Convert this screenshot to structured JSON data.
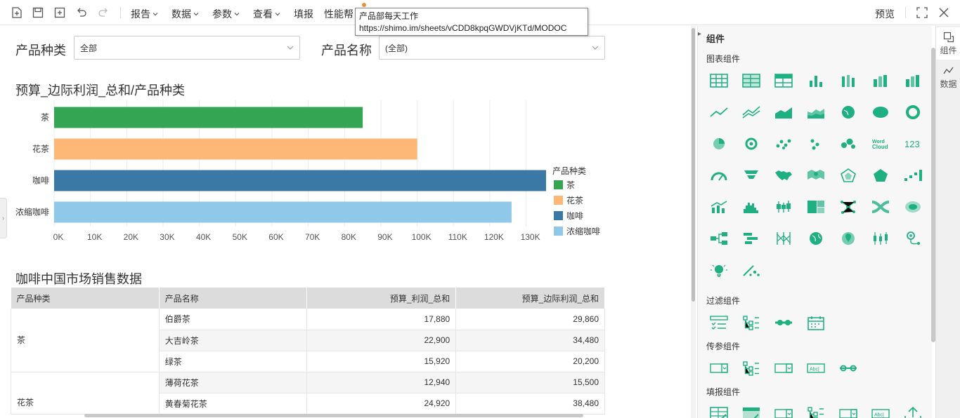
{
  "toolbar": {
    "menus": [
      {
        "id": "report",
        "label": "报告"
      },
      {
        "id": "data",
        "label": "数据"
      },
      {
        "id": "params",
        "label": "参数"
      },
      {
        "id": "view",
        "label": "查看"
      },
      {
        "id": "fill",
        "label": "填报"
      },
      {
        "id": "perf",
        "label": "性能帮"
      }
    ],
    "preview_label": "预览"
  },
  "tooltip": {
    "line1": "产品部每天工作",
    "line2": "https://shimo.im/sheets/vCDD8kpqGWDVjKTd/MODOC"
  },
  "filters": {
    "category_label": "产品种类",
    "category_value": "全部",
    "name_label": "产品名称",
    "name_value": "(全部)"
  },
  "chart_data": {
    "type": "bar",
    "orientation": "horizontal",
    "title": "预算_边际利润_总和/产品种类",
    "categories": [
      "茶",
      "花茶",
      "咖啡",
      "浓缩咖啡"
    ],
    "values": [
      85000,
      100000,
      135500,
      126000
    ],
    "colors": [
      "#34a552",
      "#fdb878",
      "#3a78a6",
      "#8fc8e8"
    ],
    "xlim": [
      0,
      135500
    ],
    "xticks": [
      "0K",
      "10K",
      "20K",
      "30K",
      "40K",
      "50K",
      "60K",
      "70K",
      "80K",
      "90K",
      "100K",
      "110K",
      "120K",
      "130K"
    ],
    "grid": true,
    "legend": {
      "title": "产品种类",
      "placement": "right",
      "items": [
        "茶",
        "花茶",
        "咖啡",
        "浓缩咖啡"
      ]
    }
  },
  "table": {
    "title": "咖啡中国市场销售数据",
    "headers": [
      "产品种类",
      "产品名称",
      "预算_利润_总和",
      "预算_边际利润_总和"
    ],
    "groups": [
      {
        "category": "茶",
        "rows": [
          {
            "name": "伯爵茶",
            "profit": "17,880",
            "margin": "29,860"
          },
          {
            "name": "大吉岭茶",
            "profit": "22,900",
            "margin": "34,480"
          },
          {
            "name": "绿茶",
            "profit": "15,920",
            "margin": "20,200"
          }
        ]
      },
      {
        "category": "花茶",
        "rows": [
          {
            "name": "薄荷花茶",
            "profit": "12,940",
            "margin": "15,500"
          },
          {
            "name": "黄春菊花茶",
            "profit": "24,920",
            "margin": "38,480"
          }
        ]
      }
    ]
  },
  "panel": {
    "title": "组件",
    "sections": {
      "chart": "图表组件",
      "filter": "过滤组件",
      "param": "传参组件",
      "fill": "填报组件"
    },
    "accent": "#1fb082"
  },
  "sidetabs": [
    {
      "id": "components",
      "label": "组件"
    },
    {
      "id": "data",
      "label": "数据"
    }
  ]
}
